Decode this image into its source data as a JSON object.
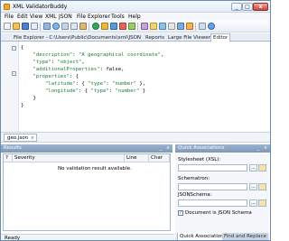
{
  "window": {
    "title": "XML ValidatorBuddy",
    "close_glyph": "x",
    "min_glyph": "_",
    "max_glyph": "□"
  },
  "menu": [
    "File",
    "Edit",
    "View",
    "XML",
    "JSON",
    "File Explorer",
    "Tools",
    "Help"
  ],
  "doc_tabs": {
    "file_explorer": "File Explorer - C:\\Users\\Public\\Documents\\xml\\JSON",
    "reports": "Reports",
    "large_file_viewer": "Large File Viewer",
    "editor": "Editor"
  },
  "editor": {
    "lines": [
      {
        "indent": "",
        "parts": [
          {
            "t": "{",
            "c": "p"
          }
        ]
      },
      {
        "indent": "    ",
        "parts": [
          {
            "t": "\"description\"",
            "c": "k"
          },
          {
            "t": ": ",
            "c": "p"
          },
          {
            "t": "\"A geographical coordinate\"",
            "c": "k"
          },
          {
            "t": ",",
            "c": "p"
          }
        ]
      },
      {
        "indent": "    ",
        "parts": [
          {
            "t": "\"type\"",
            "c": "k"
          },
          {
            "t": ": ",
            "c": "p"
          },
          {
            "t": "\"object\"",
            "c": "k"
          },
          {
            "t": ",",
            "c": "p"
          }
        ]
      },
      {
        "indent": "    ",
        "parts": [
          {
            "t": "\"additionalProperties\"",
            "c": "k"
          },
          {
            "t": ": false,",
            "c": "p"
          }
        ]
      },
      {
        "indent": "    ",
        "parts": [
          {
            "t": "\"properties\"",
            "c": "k"
          },
          {
            "t": ": {",
            "c": "p"
          }
        ]
      },
      {
        "indent": "        ",
        "parts": [
          {
            "t": "\"latitude\"",
            "c": "k"
          },
          {
            "t": ": { ",
            "c": "p"
          },
          {
            "t": "\"type\"",
            "c": "k"
          },
          {
            "t": ": ",
            "c": "p"
          },
          {
            "t": "\"number\"",
            "c": "k"
          },
          {
            "t": " },",
            "c": "p"
          }
        ]
      },
      {
        "indent": "        ",
        "parts": [
          {
            "t": "\"longitude\"",
            "c": "k"
          },
          {
            "t": ": { ",
            "c": "p"
          },
          {
            "t": "\"type\"",
            "c": "k"
          },
          {
            "t": ": ",
            "c": "p"
          },
          {
            "t": "\"number\"",
            "c": "k"
          },
          {
            "t": " }",
            "c": "p"
          }
        ]
      },
      {
        "indent": "    ",
        "parts": [
          {
            "t": "}",
            "c": "p"
          }
        ]
      },
      {
        "indent": "",
        "parts": [
          {
            "t": "}",
            "c": "p"
          }
        ]
      }
    ],
    "fold_glyph": "-"
  },
  "file_tab": {
    "name": "geo.json",
    "close": "x"
  },
  "results": {
    "title": "Results",
    "columns": [
      "?",
      "Severity",
      "Line",
      "Char"
    ],
    "empty_message": "No validation result available."
  },
  "quick_associations": {
    "title": "Quick Associations",
    "stylesheet_label": "Stylesheet (XSL):",
    "schematron_label": "Schematron:",
    "json_schema_label": "JSONSchema:",
    "browse_glyph": "...",
    "checkbox_label": "Document is JSON Schema",
    "checkbox_checked": true,
    "check_glyph": "✓"
  },
  "bottom_tabs": {
    "quick_associations": "Quick Associations",
    "find_replace": "Find and Replace"
  },
  "status": {
    "text": "Ready"
  },
  "colors": {
    "accent": "#7f98b9",
    "json_key": "#1e7a36"
  }
}
